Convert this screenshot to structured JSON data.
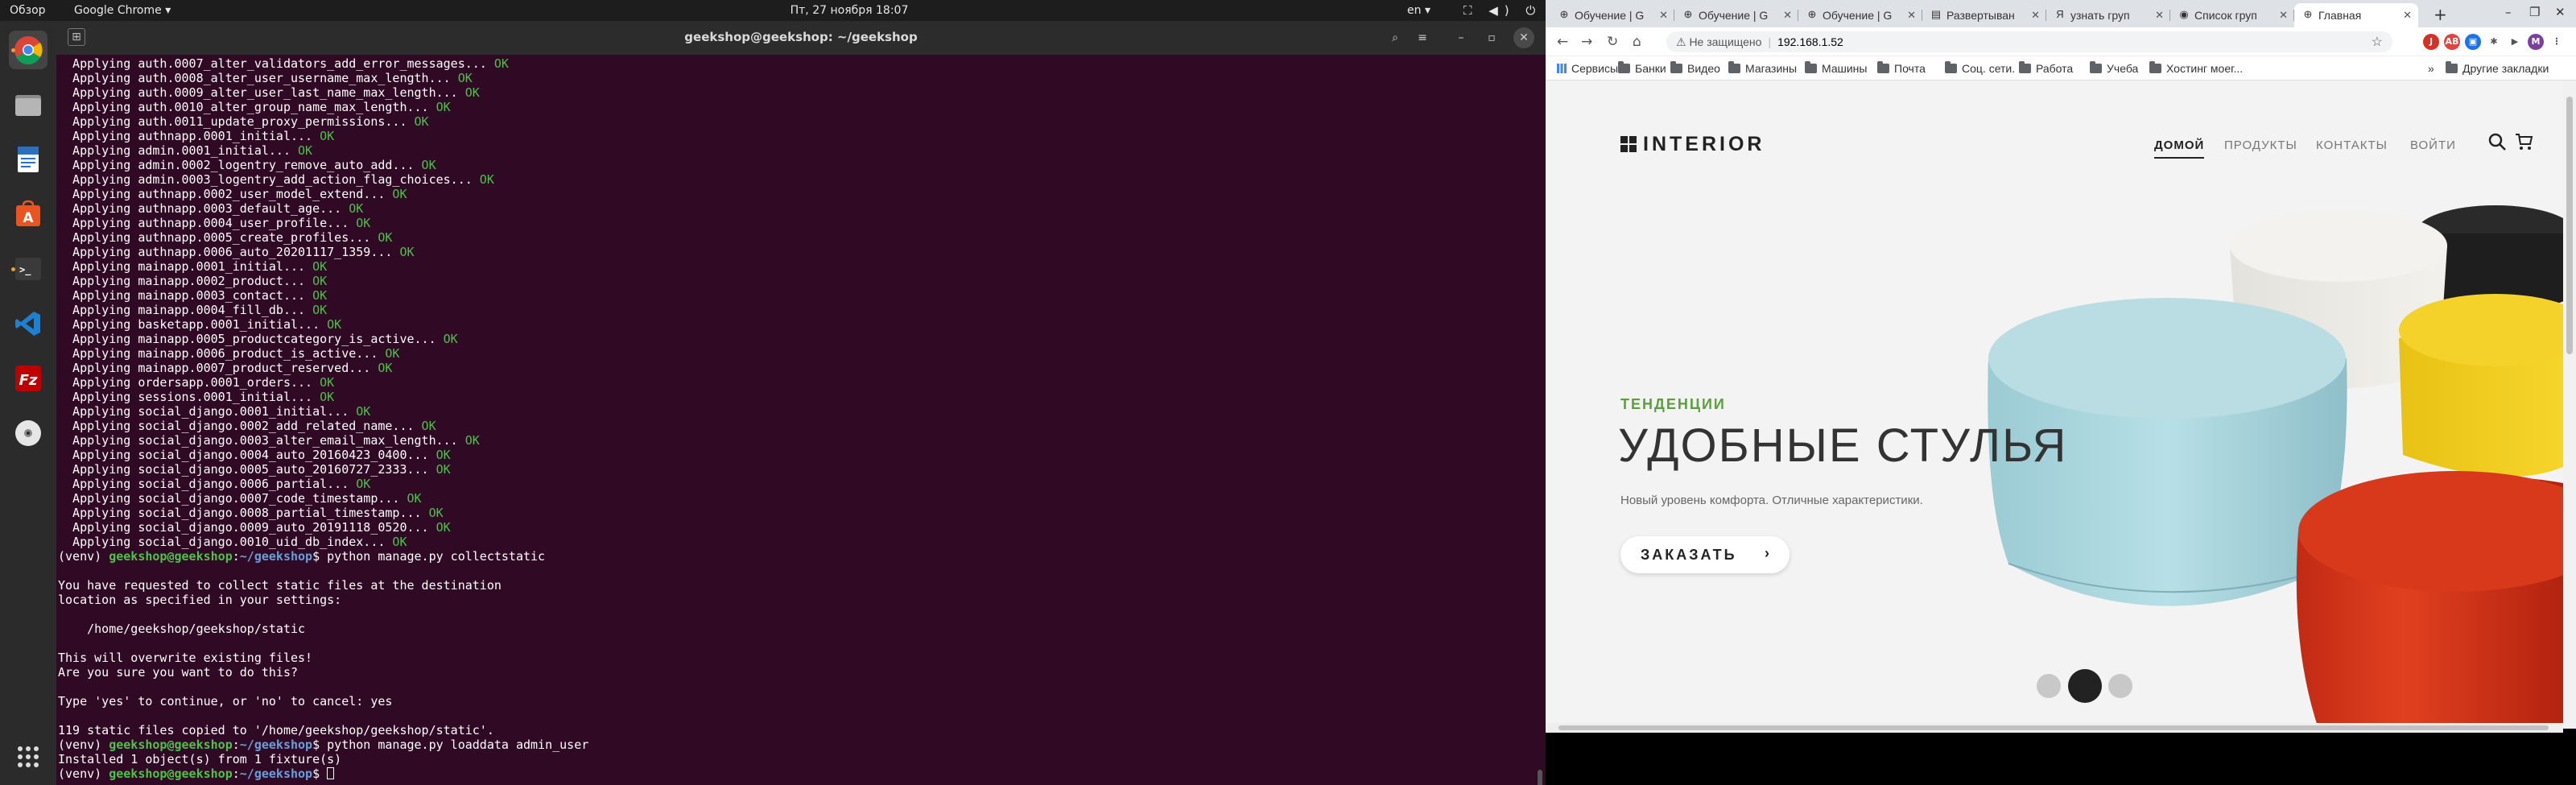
{
  "topbar": {
    "overview": "Обзор",
    "app_name": "Google Chrome",
    "app_arrow": "▾",
    "clock": "Пт, 27 ноября  18:07",
    "lang": "en",
    "lang_arrow": "▾",
    "tray": "⛶ ◀) ⏻ ▾"
  },
  "dock": {
    "items": [
      {
        "name": "chrome",
        "glyph": "",
        "color": "#dd4b39"
      },
      {
        "name": "files",
        "glyph": "",
        "color": "#8a8a8a"
      },
      {
        "name": "writer",
        "glyph": "",
        "color": "#2a6fc0"
      },
      {
        "name": "software",
        "glyph": "A",
        "color": "#e95420"
      },
      {
        "name": "terminal",
        "glyph": ">_",
        "color": "#333333"
      },
      {
        "name": "vscode",
        "glyph": "⋊",
        "color": "#1f7fd0"
      },
      {
        "name": "filezilla",
        "glyph": "Fz",
        "color": "#c4161c"
      },
      {
        "name": "disc",
        "glyph": "◉",
        "color": "#bbbbbb"
      }
    ],
    "apps_glyph": "⋮⋮⋮"
  },
  "terminal": {
    "title": "geekshop@geekshop: ~/geekshop",
    "lines": [
      {
        "t": "  Applying auth.0007_alter_validators_add_error_messages...",
        "ok": " OK"
      },
      {
        "t": "  Applying auth.0008_alter_user_username_max_length...",
        "ok": " OK"
      },
      {
        "t": "  Applying auth.0009_alter_user_last_name_max_length...",
        "ok": " OK"
      },
      {
        "t": "  Applying auth.0010_alter_group_name_max_length...",
        "ok": " OK"
      },
      {
        "t": "  Applying auth.0011_update_proxy_permissions...",
        "ok": " OK"
      },
      {
        "t": "  Applying authnapp.0001_initial...",
        "ok": " OK"
      },
      {
        "t": "  Applying admin.0001_initial...",
        "ok": " OK"
      },
      {
        "t": "  Applying admin.0002_logentry_remove_auto_add...",
        "ok": " OK"
      },
      {
        "t": "  Applying admin.0003_logentry_add_action_flag_choices...",
        "ok": " OK"
      },
      {
        "t": "  Applying authnapp.0002_user_model_extend...",
        "ok": " OK"
      },
      {
        "t": "  Applying authnapp.0003_default_age...",
        "ok": " OK"
      },
      {
        "t": "  Applying authnapp.0004_user_profile...",
        "ok": " OK"
      },
      {
        "t": "  Applying authnapp.0005_create_profiles...",
        "ok": " OK"
      },
      {
        "t": "  Applying authnapp.0006_auto_20201117_1359...",
        "ok": " OK"
      },
      {
        "t": "  Applying mainapp.0001_initial...",
        "ok": " OK"
      },
      {
        "t": "  Applying mainapp.0002_product...",
        "ok": " OK"
      },
      {
        "t": "  Applying mainapp.0003_contact...",
        "ok": " OK"
      },
      {
        "t": "  Applying mainapp.0004_fill_db...",
        "ok": " OK"
      },
      {
        "t": "  Applying basketapp.0001_initial...",
        "ok": " OK"
      },
      {
        "t": "  Applying mainapp.0005_productcategory_is_active...",
        "ok": " OK"
      },
      {
        "t": "  Applying mainapp.0006_product_is_active...",
        "ok": " OK"
      },
      {
        "t": "  Applying mainapp.0007_product_reserved...",
        "ok": " OK"
      },
      {
        "t": "  Applying ordersapp.0001_orders...",
        "ok": " OK"
      },
      {
        "t": "  Applying sessions.0001_initial...",
        "ok": " OK"
      },
      {
        "t": "  Applying social_django.0001_initial...",
        "ok": " OK"
      },
      {
        "t": "  Applying social_django.0002_add_related_name...",
        "ok": " OK"
      },
      {
        "t": "  Applying social_django.0003_alter_email_max_length...",
        "ok": " OK"
      },
      {
        "t": "  Applying social_django.0004_auto_20160423_0400...",
        "ok": " OK"
      },
      {
        "t": "  Applying social_django.0005_auto_20160727_2333...",
        "ok": " OK"
      },
      {
        "t": "  Applying social_django.0006_partial...",
        "ok": " OK"
      },
      {
        "t": "  Applying social_django.0007_code_timestamp...",
        "ok": " OK"
      },
      {
        "t": "  Applying social_django.0008_partial_timestamp...",
        "ok": " OK"
      },
      {
        "t": "  Applying social_django.0009_auto_20191118_0520...",
        "ok": " OK"
      },
      {
        "t": "  Applying social_django.0010_uid_db_index...",
        "ok": " OK"
      },
      {
        "prompt": true,
        "cmd": " python manage.py collectstatic"
      },
      {
        "t": ""
      },
      {
        "t": "You have requested to collect static files at the destination"
      },
      {
        "t": "location as specified in your settings:"
      },
      {
        "t": ""
      },
      {
        "t": "    /home/geekshop/geekshop/static"
      },
      {
        "t": ""
      },
      {
        "t": "This will overwrite existing files!"
      },
      {
        "t": "Are you sure you want to do this?"
      },
      {
        "t": ""
      },
      {
        "t": "Type 'yes' to continue, or 'no' to cancel: yes"
      },
      {
        "t": ""
      },
      {
        "t": "119 static files copied to '/home/geekshop/geekshop/static'."
      },
      {
        "prompt": true,
        "cmd": " python manage.py loaddata admin_user"
      },
      {
        "t": "Installed 1 object(s) from 1 fixture(s)"
      },
      {
        "prompt": true,
        "cmd": " ",
        "cursor": true
      }
    ],
    "prompt_venv": "(venv) ",
    "prompt_user": "geekshop@geekshop",
    "prompt_colon": ":",
    "prompt_path": "~/geekshop",
    "prompt_dollar": "$"
  },
  "browser": {
    "tabs": [
      {
        "icon": "⊕",
        "label": "Обучение | G"
      },
      {
        "icon": "⊕",
        "label": "Обучение | G"
      },
      {
        "icon": "⊕",
        "label": "Обучение | G"
      },
      {
        "icon": "▤",
        "label": "Развертыван"
      },
      {
        "icon": "Я",
        "label": "узнать груп"
      },
      {
        "icon": "◉",
        "label": "Список груп"
      },
      {
        "icon": "⊕",
        "label": "Главная",
        "active": true
      }
    ],
    "tab_close": "✕",
    "new_tab": "+",
    "window_controls": [
      "–",
      "❐",
      "✕"
    ],
    "nav": {
      "back": "←",
      "forward": "→",
      "reload": "↻",
      "home": "⌂"
    },
    "address": {
      "warning": "⚠ Не защищено",
      "url": "192.168.1.52",
      "star": "☆"
    },
    "extensions": [
      {
        "glyph": "J",
        "color": "#d93025"
      },
      {
        "glyph": "AB",
        "color": "#e0443e"
      },
      {
        "glyph": "▣",
        "color": "#1a73e8"
      },
      {
        "glyph": "✱",
        "color": "#555555"
      },
      {
        "glyph": "▶",
        "color": "#555555"
      },
      {
        "glyph": "M",
        "color": "#7b3fa0"
      },
      {
        "glyph": "⋮",
        "color": "#555555"
      }
    ],
    "bookmarks": {
      "apps": "Сервисы",
      "folders": [
        "Банки",
        "Видео",
        "Магазины",
        "Машины",
        "Почта",
        "Соц. сети.",
        "Работа",
        "Учеба",
        "Хостинг моег..."
      ],
      "more": "»",
      "other": "Другие закладки"
    }
  },
  "site": {
    "logo": "INTERIOR",
    "menu": [
      {
        "label": "ДОМОЙ",
        "active": true
      },
      {
        "label": "ПРОДУКТЫ"
      },
      {
        "label": "КОНТАКТЫ"
      },
      {
        "label": "ВОЙТИ"
      }
    ],
    "search_icon": "⌕",
    "cart_icon": "🛒",
    "trend": "ТЕНДЕНЦИИ",
    "headline": "УДОБНЫЕ СТУЛЬЯ",
    "subtext": "Новый уровень комфорта. Отличные характеристики.",
    "order_button": "ЗАКАЗАТЬ",
    "order_arrow": "›",
    "slider_active": 2,
    "slider_count": 3
  },
  "colors": {
    "terminal_bg": "#300a24",
    "ok_green": "#4ec14a",
    "prompt_blue": "#6a9eda",
    "trend_green": "#5aa03c",
    "pouf_blue": "#a9d5dd",
    "pouf_red": "#d9341c",
    "pouf_yellow": "#f2cf1f"
  }
}
